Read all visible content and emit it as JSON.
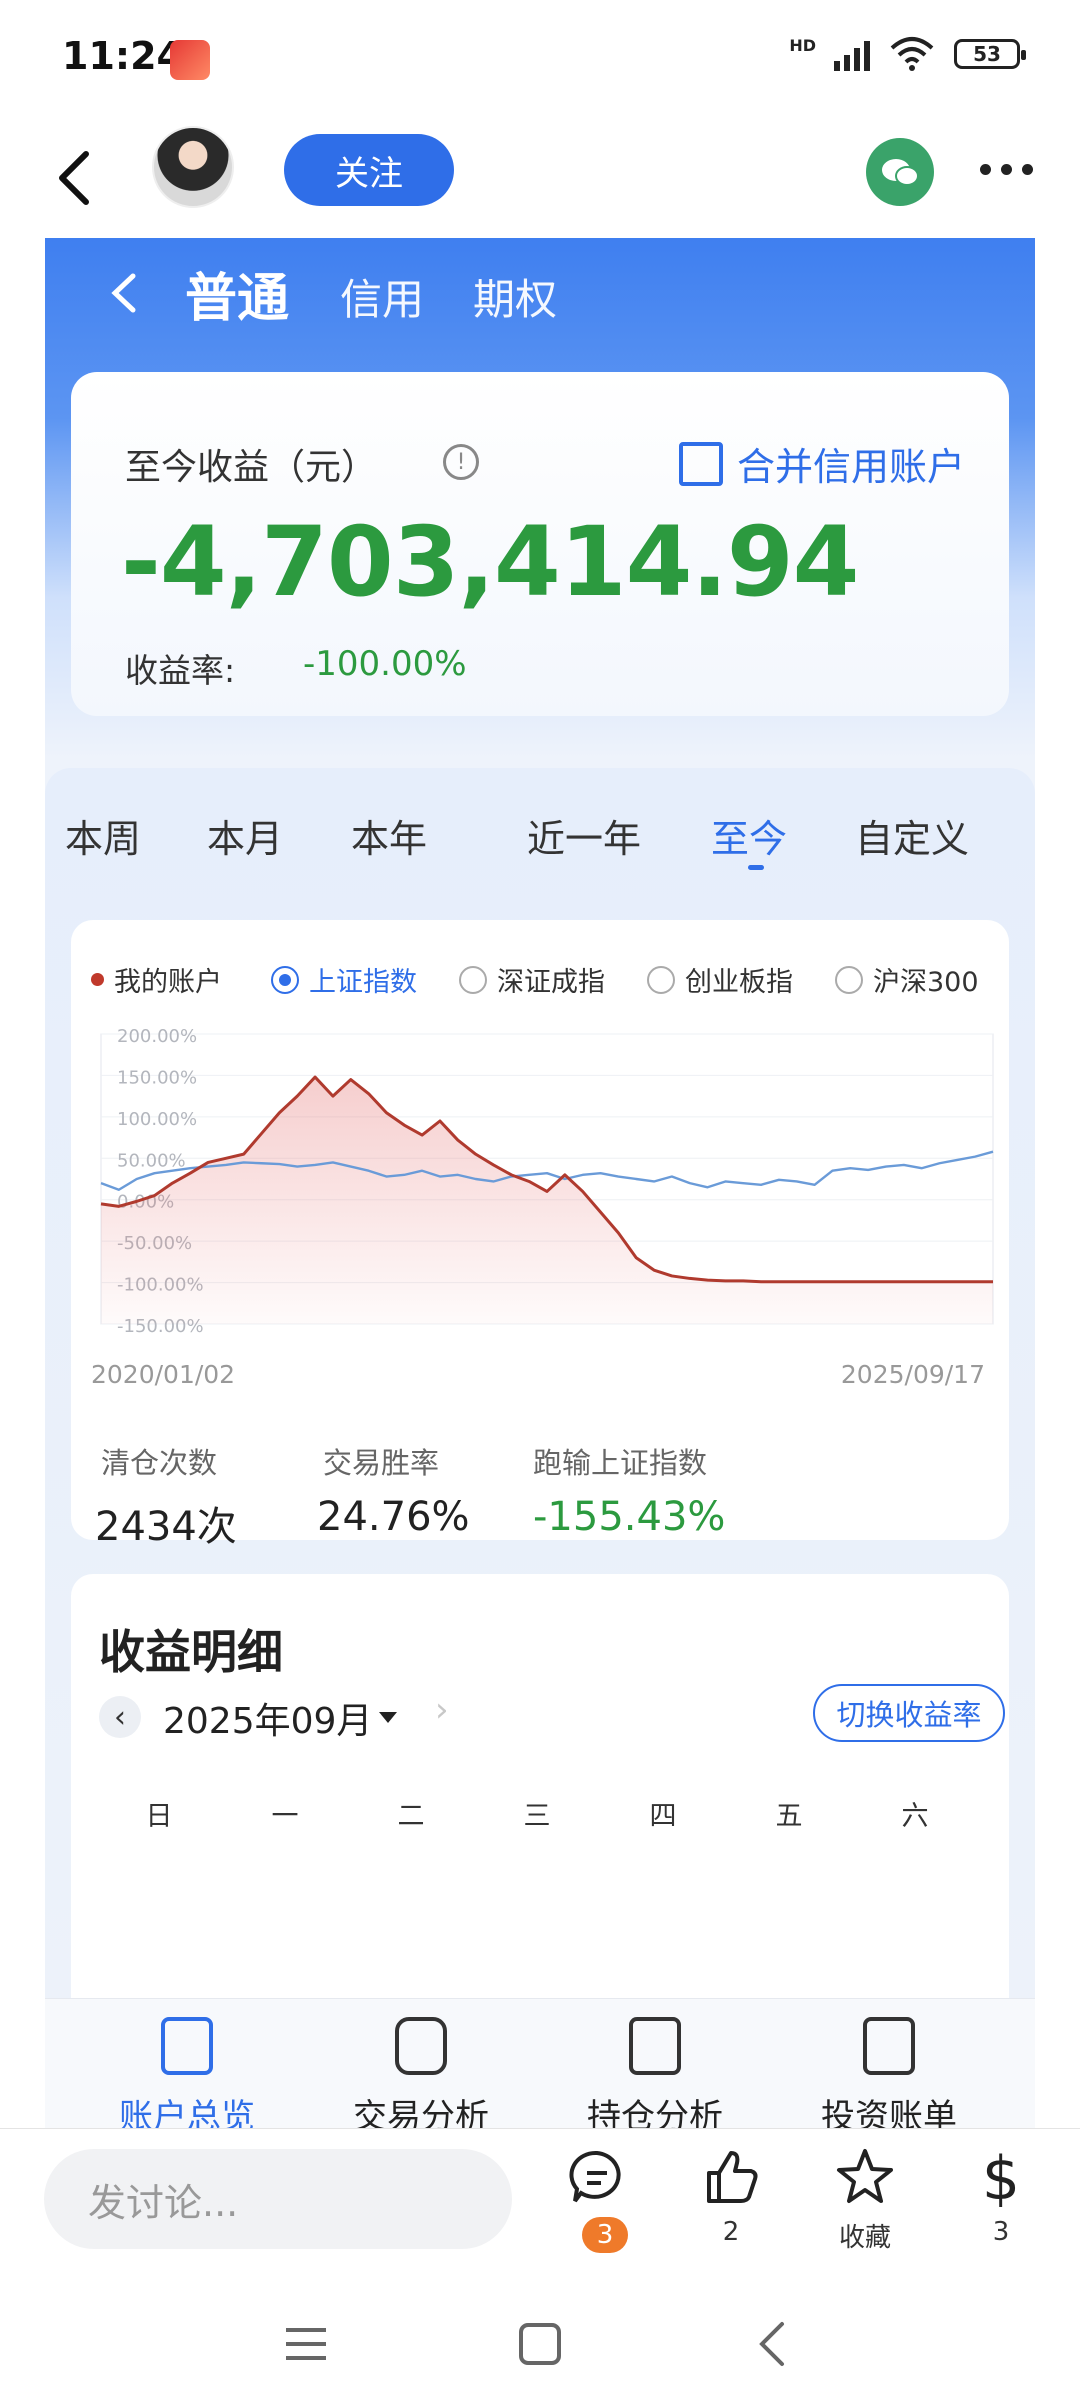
{
  "status_bar": {
    "time": "11:24",
    "network": "HD",
    "battery": "53"
  },
  "post_header": {
    "follow_label": "关注"
  },
  "app": {
    "account_tabs": [
      "普通",
      "信用",
      "期权"
    ],
    "summary": {
      "label": "至今收益（元）",
      "info_icon": "!",
      "merge_label": "合并信用账户",
      "total": "-4,703,414.94",
      "rate_label": "收益率:",
      "rate_value": "-100.00%"
    },
    "period_tabs": [
      "本周",
      "本月",
      "本年",
      "近一年",
      "至今",
      "自定义"
    ],
    "active_period": "至今",
    "legend": [
      {
        "label": "我的账户",
        "type": "dot"
      },
      {
        "label": "上证指数",
        "type": "radio",
        "selected": true
      },
      {
        "label": "深证成指",
        "type": "radio"
      },
      {
        "label": "创业板指",
        "type": "radio"
      },
      {
        "label": "沪深300",
        "type": "radio"
      }
    ],
    "chart_data": {
      "type": "line",
      "x_start": "2020/01/02",
      "x_end": "2025/09/17",
      "y_ticks": [
        "200.00%",
        "150.00%",
        "100.00%",
        "50.00%",
        "0.00%",
        "-50.00%",
        "-100.00%",
        "-150.00%"
      ],
      "ylim": [
        -150,
        200
      ],
      "series": [
        {
          "name": "我的账户",
          "color": "#b03a2e",
          "x": [
            0,
            2,
            4,
            6,
            8,
            10,
            12,
            14,
            16,
            18,
            20,
            22,
            24,
            26,
            28,
            30,
            32,
            34,
            36,
            38,
            40,
            42,
            44,
            46,
            48,
            50,
            52,
            54,
            56,
            58,
            60,
            62,
            64,
            66,
            68,
            70,
            72,
            74,
            76,
            78,
            80,
            82,
            84,
            86,
            88,
            90,
            92,
            94,
            96,
            98,
            100
          ],
          "values": [
            -5,
            -8,
            -2,
            5,
            20,
            32,
            45,
            50,
            55,
            80,
            105,
            125,
            148,
            125,
            145,
            128,
            105,
            90,
            78,
            95,
            72,
            55,
            42,
            30,
            22,
            10,
            30,
            10,
            -15,
            -40,
            -70,
            -85,
            -92,
            -95,
            -97,
            -98,
            -98,
            -99,
            -99,
            -99,
            -99,
            -99,
            -99,
            -99,
            -99,
            -99,
            -99,
            -99,
            -99,
            -99,
            -99
          ]
        },
        {
          "name": "上证指数",
          "color": "#6a9bd8",
          "x": [
            0,
            2,
            4,
            6,
            8,
            10,
            12,
            14,
            16,
            18,
            20,
            22,
            24,
            26,
            28,
            30,
            32,
            34,
            36,
            38,
            40,
            42,
            44,
            46,
            48,
            50,
            52,
            54,
            56,
            58,
            60,
            62,
            64,
            66,
            68,
            70,
            72,
            74,
            76,
            78,
            80,
            82,
            84,
            86,
            88,
            90,
            92,
            94,
            96,
            98,
            100
          ],
          "values": [
            20,
            12,
            25,
            32,
            35,
            38,
            40,
            42,
            45,
            44,
            43,
            40,
            42,
            45,
            40,
            35,
            28,
            30,
            35,
            28,
            30,
            25,
            22,
            28,
            30,
            32,
            25,
            30,
            32,
            28,
            25,
            22,
            28,
            20,
            15,
            22,
            20,
            18,
            24,
            22,
            18,
            35,
            38,
            36,
            40,
            42,
            38,
            44,
            48,
            52,
            58
          ]
        }
      ]
    },
    "stats": [
      {
        "label": "清仓次数",
        "value": "2434次"
      },
      {
        "label": "交易胜率",
        "value": "24.76%"
      },
      {
        "label": "跑输上证指数",
        "value": "-155.43%"
      }
    ],
    "detail": {
      "title": "收益明细",
      "month": "2025年09月",
      "switch_label": "切换收益率",
      "weekdays": [
        "日",
        "一",
        "二",
        "三",
        "四",
        "五",
        "六"
      ]
    },
    "bottom_nav": [
      {
        "label": "账户总览",
        "icon": "report-clock-icon",
        "active": true
      },
      {
        "label": "交易分析",
        "icon": "exchange-icon"
      },
      {
        "label": "持仓分析",
        "icon": "bar-chart-icon"
      },
      {
        "label": "投资账单",
        "icon": "bill-icon"
      }
    ]
  },
  "forum_bar": {
    "discuss_placeholder": "发讨论...",
    "comment_count": "3",
    "like_count": "2",
    "favorite_label": "收藏",
    "reward_count": "3"
  }
}
